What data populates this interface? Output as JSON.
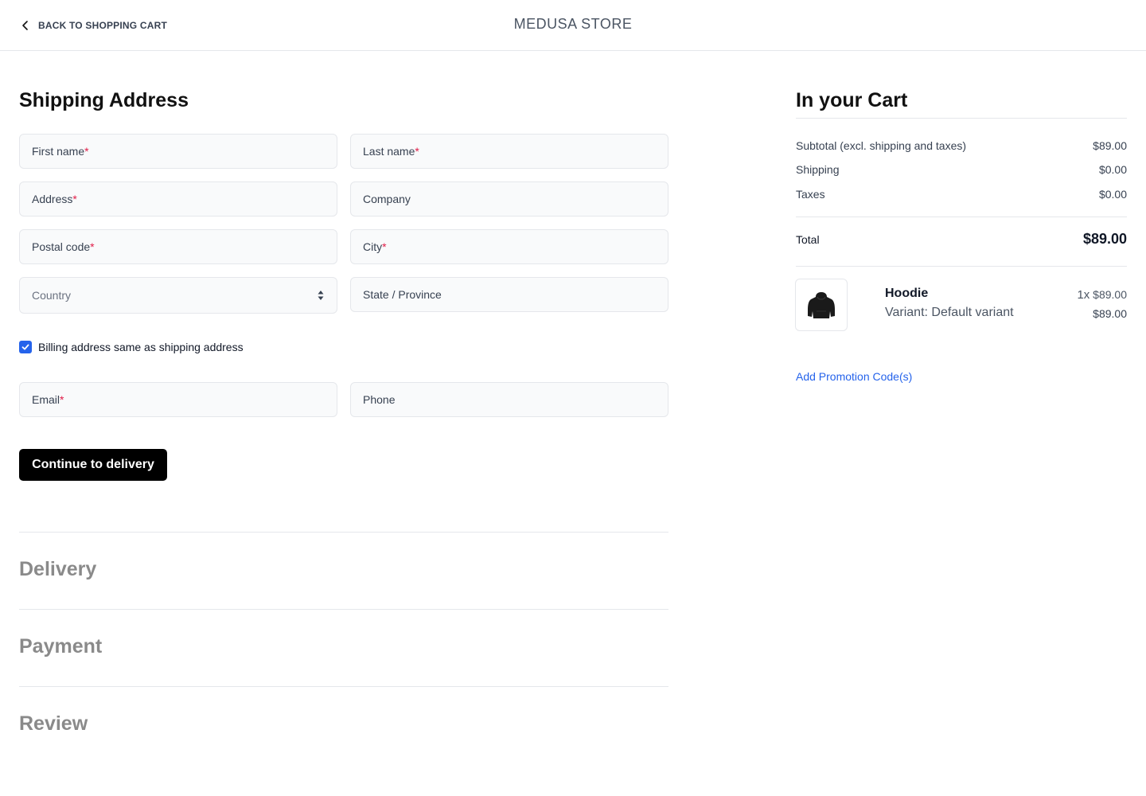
{
  "header": {
    "back_label": "BACK TO SHOPPING CART",
    "store_name": "MEDUSA STORE"
  },
  "shipping": {
    "title": "Shipping Address",
    "fields": {
      "first_name": "First name",
      "last_name": "Last name",
      "address": "Address",
      "company": "Company",
      "postal_code": "Postal code",
      "city": "City",
      "country": "Country",
      "state": "State / Province",
      "email": "Email",
      "phone": "Phone"
    },
    "required_mark": "*",
    "billing_same_label": "Billing address same as shipping address",
    "billing_same_checked": true,
    "continue_label": "Continue to delivery"
  },
  "steps": {
    "delivery": "Delivery",
    "payment": "Payment",
    "review": "Review"
  },
  "cart": {
    "title": "In your Cart",
    "subtotal_label": "Subtotal (excl. shipping and taxes)",
    "subtotal_value": "$89.00",
    "shipping_label": "Shipping",
    "shipping_value": "$0.00",
    "taxes_label": "Taxes",
    "taxes_value": "$0.00",
    "total_label": "Total",
    "total_value": "$89.00",
    "item": {
      "name": "Hoodie",
      "variant": "Variant: Default variant",
      "quantity": "1x",
      "unit_price": "$89.00",
      "line_total": "$89.00"
    },
    "promo_label": "Add Promotion Code(s)"
  },
  "colors": {
    "accent": "#2563eb",
    "required": "#e11d48",
    "button_bg": "#000000"
  }
}
